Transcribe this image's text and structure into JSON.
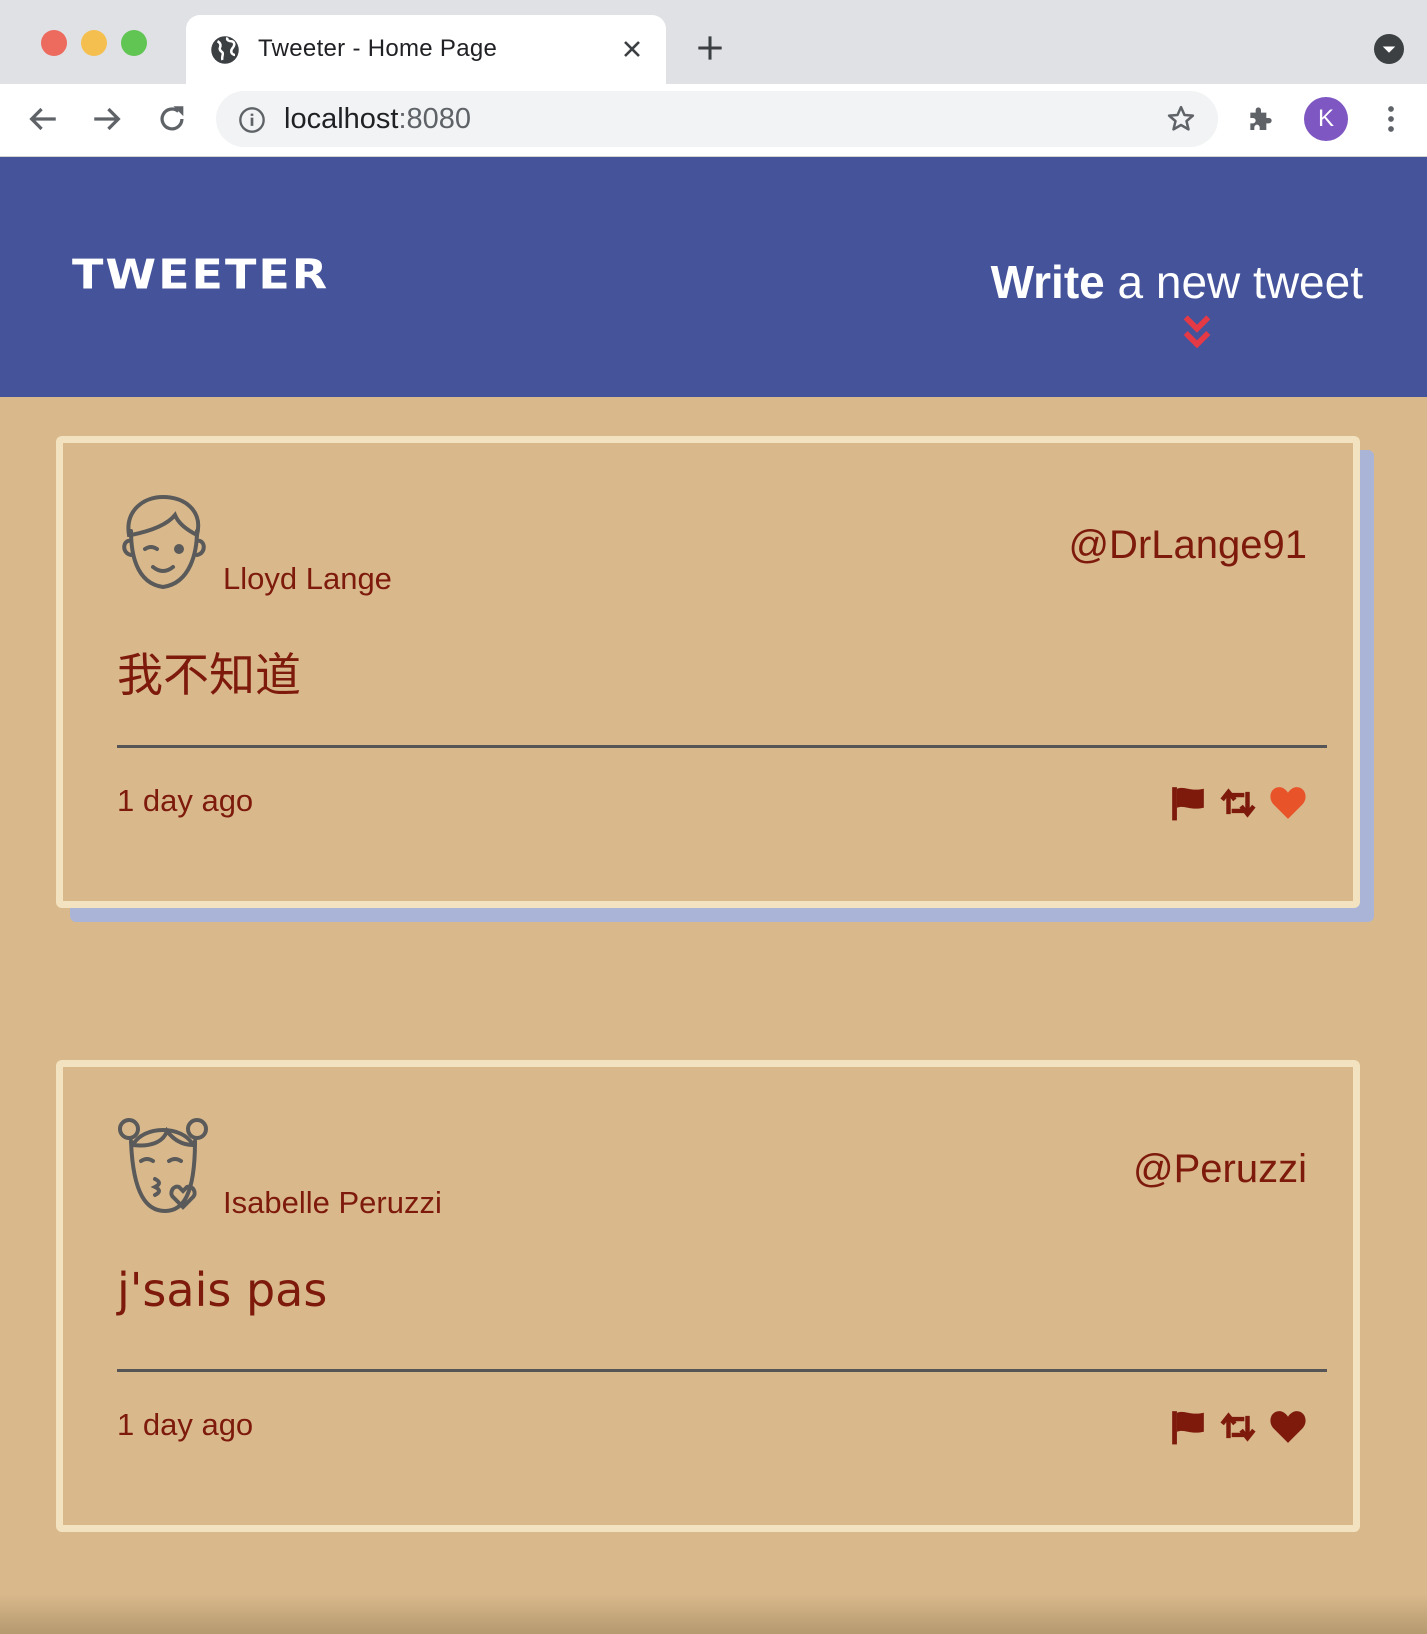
{
  "browser": {
    "tab_title": "Tweeter - Home Page",
    "url_host": "localhost",
    "url_port": ":8080",
    "profile_initial": "K"
  },
  "header": {
    "brand": "TWEETER",
    "compose_bold": "Write",
    "compose_rest": " a new tweet",
    "accent_color": "#e63946"
  },
  "tweets": [
    {
      "avatar": "boy-face-icon",
      "name": "Lloyd Lange",
      "handle": "@DrLange91",
      "text": "我不知道",
      "time": "1 day ago",
      "liked": true
    },
    {
      "avatar": "girl-face-icon",
      "name": "Isabelle Peruzzi",
      "handle": "@Peruzzi",
      "text": "j'sais pas",
      "time": "1 day ago",
      "liked": false
    }
  ],
  "colors": {
    "header_bg": "#44539a",
    "page_bg": "#d9b98c",
    "text": "#7d1a0c",
    "like_active": "#e8532a"
  }
}
